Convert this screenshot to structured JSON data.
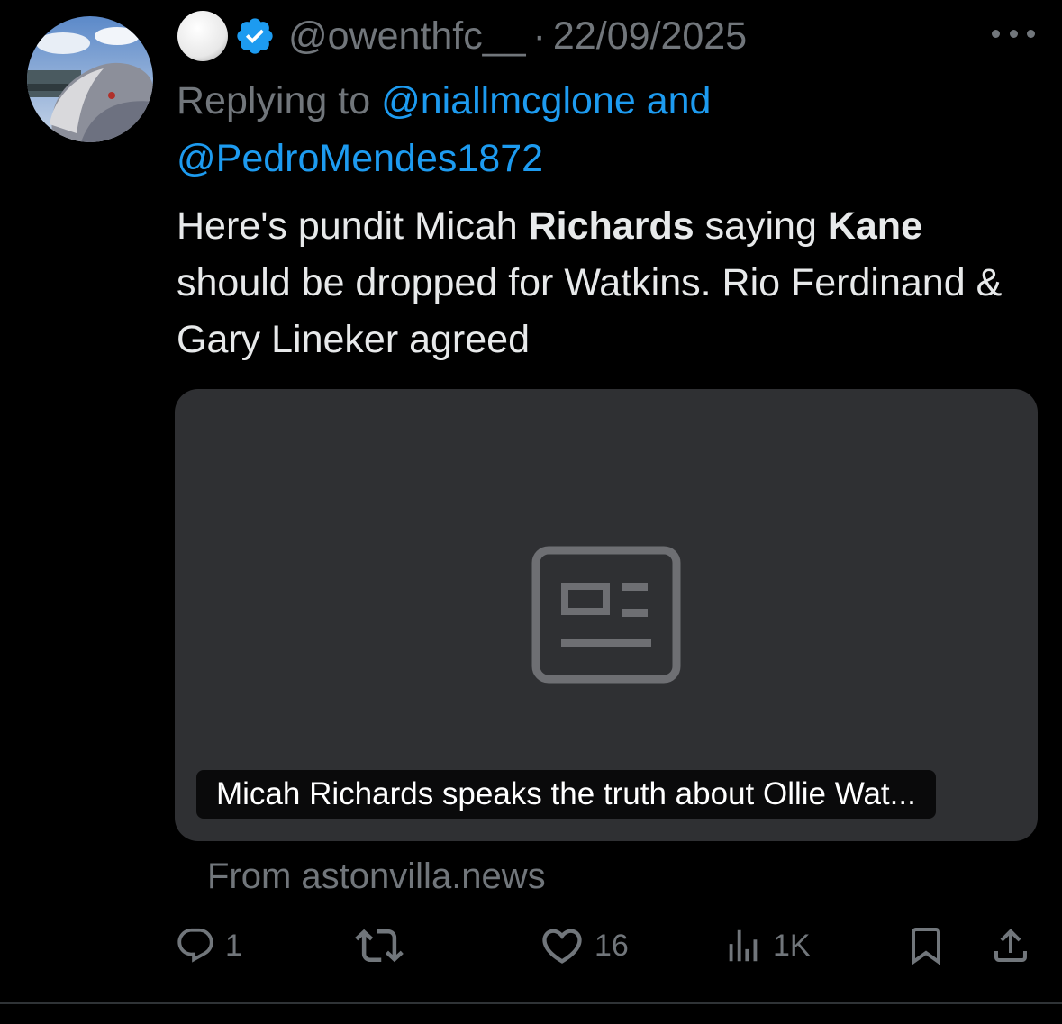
{
  "tweet": {
    "handle": "@owenthfc__",
    "separator": "·",
    "date": "22/09/2025",
    "replying_prefix": "Replying to ",
    "reply_mention_1": "@niallmcglone",
    "reply_and": " and",
    "reply_mention_2": "@PedroMendes1872",
    "text": {
      "part1": "Here's pundit Micah ",
      "bold1": "Richards",
      "part2": " saying ",
      "bold2": "Kane",
      "part3": " should be dropped for Watkins. Rio Ferdinand & Gary Lineker agreed"
    },
    "card": {
      "title": "Micah Richards speaks the truth about Ollie Wat...",
      "icon": "article-icon"
    },
    "source": "From astonvilla.news"
  },
  "actions": {
    "reply_count": "1",
    "retweet_count": "",
    "like_count": "16",
    "views_count": "1K"
  },
  "colors": {
    "background": "#000000",
    "text": "#e7e9ea",
    "muted": "#71767b",
    "link": "#1d9bf0",
    "card": "#2f3033"
  }
}
